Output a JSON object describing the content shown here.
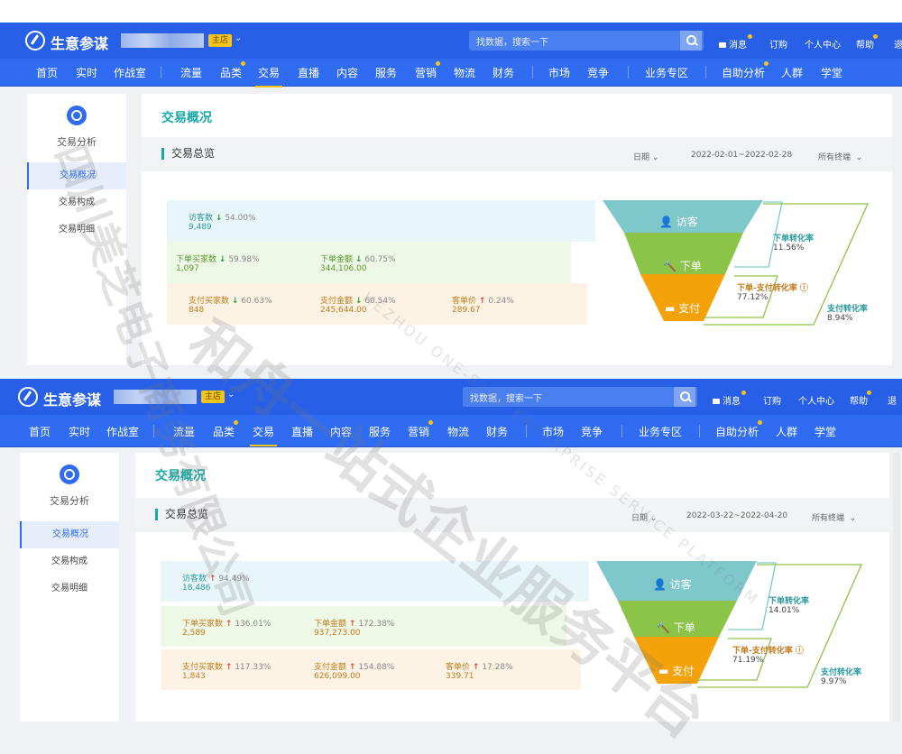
{
  "brand": "生意参谋",
  "shop_tag": "主店",
  "search_placeholder": "找数据，搜索一下",
  "top_links": [
    "消息",
    "订购",
    "个人中心",
    "帮助",
    "退"
  ],
  "nav": [
    "首页",
    "实时",
    "作战室",
    "流量",
    "品类",
    "交易",
    "直播",
    "内容",
    "服务",
    "营销",
    "物流",
    "财务",
    "市场",
    "竞争",
    "业务专区",
    "自助分析",
    "人群",
    "学堂"
  ],
  "sidebar": {
    "title": "交易分析",
    "items": [
      "交易概况",
      "交易构成",
      "交易明细"
    ]
  },
  "page_title": "交易概况",
  "section_title": "交易总览",
  "date_label": "日期",
  "terminal_label": "所有终端",
  "watermark": "和舟一站式企业服务平台",
  "watermark_sub": "HEZHOU ONE-STOP ENTERPRISE SERVICE PLATFORM",
  "watermark_left": "四川美芝电子商务有限公司",
  "colors": {
    "topbar": "#2760e6",
    "accent": "#15a9a6",
    "visitor": "#7ec8cc",
    "order": "#8cc44a",
    "pay": "#f4a20a"
  },
  "panels": [
    {
      "date_range": "2022-02-01~2022-02-28",
      "visitors": {
        "label": "访客数",
        "trend": "down",
        "pct": "54.00%",
        "value": "9,489"
      },
      "order_buyers": {
        "label": "下单买家数",
        "trend": "down",
        "pct": "59.98%",
        "value": "1,097"
      },
      "order_amount": {
        "label": "下单金额",
        "trend": "down",
        "pct": "60.75%",
        "value": "344,106.00"
      },
      "pay_buyers": {
        "label": "支付买家数",
        "trend": "down",
        "pct": "60.63%",
        "value": "848"
      },
      "pay_amount": {
        "label": "支付金额",
        "trend": "down",
        "pct": "60.54%",
        "value": "245,644.00"
      },
      "unit_price": {
        "label": "客单价",
        "trend": "up",
        "pct": "0.24%",
        "value": "289.67"
      },
      "funnel": {
        "visitor": "访客",
        "order": "下单",
        "pay": "支付",
        "order_conv_label": "下单转化率",
        "order_conv": "11.56%",
        "order_pay_label": "下单-支付转化率",
        "order_pay": "77.12%",
        "pay_conv_label": "支付转化率",
        "pay_conv": "8.94%"
      }
    },
    {
      "date_range": "2022-03-22~2022-04-20",
      "visitors": {
        "label": "访客数",
        "trend": "up",
        "pct": "94.49%",
        "value": "18,486"
      },
      "order_buyers": {
        "label": "下单买家数",
        "trend": "up",
        "pct": "136.01%",
        "value": "2,589"
      },
      "order_amount": {
        "label": "下单金额",
        "trend": "up",
        "pct": "172.38%",
        "value": "937,273.00"
      },
      "pay_buyers": {
        "label": "支付买家数",
        "trend": "up",
        "pct": "117.33%",
        "value": "1,843"
      },
      "pay_amount": {
        "label": "支付金额",
        "trend": "up",
        "pct": "154.88%",
        "value": "626,099.00"
      },
      "unit_price": {
        "label": "客单价",
        "trend": "up",
        "pct": "17.28%",
        "value": "339.71"
      },
      "funnel": {
        "visitor": "访客",
        "order": "下单",
        "pay": "支付",
        "order_conv_label": "下单转化率",
        "order_conv": "14.01%",
        "order_pay_label": "下单-支付转化率",
        "order_pay": "71.19%",
        "pay_conv_label": "支付转化率",
        "pay_conv": "9.97%"
      }
    }
  ]
}
